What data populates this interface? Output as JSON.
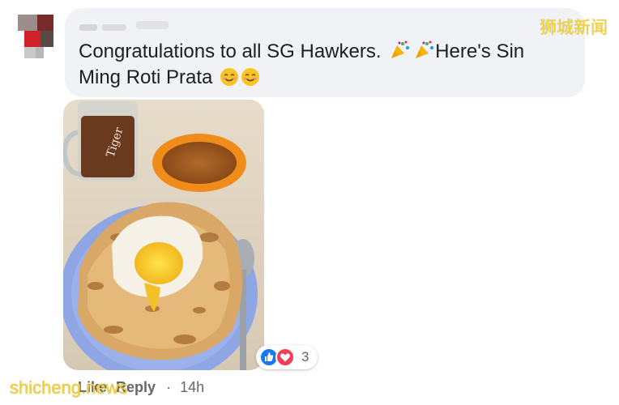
{
  "comment": {
    "text_line1": "Congratulations to all SG Hawkers.",
    "text_line2_after_emoji": "Here's Sin",
    "text_line3": "Ming Roti Prata",
    "reaction_count": "3",
    "like_label": "Like",
    "reply_label": "Reply",
    "separator": "·",
    "timestamp": "14h"
  },
  "watermarks": {
    "top_right": "狮城新闻",
    "bottom_left": "shicheng.news"
  },
  "icons": {
    "reaction_like": "thumbs-up-icon",
    "reaction_love": "heart-icon",
    "emoji_party": "party-popper-icon",
    "emoji_smile": "smiling-face-icon"
  },
  "colors": {
    "bubble_bg": "#f0f2f5",
    "like_blue": "#1877f2",
    "love_red": "#f33e58",
    "meta_gray": "#65676b",
    "watermark_yellow": "#f4d43a"
  }
}
